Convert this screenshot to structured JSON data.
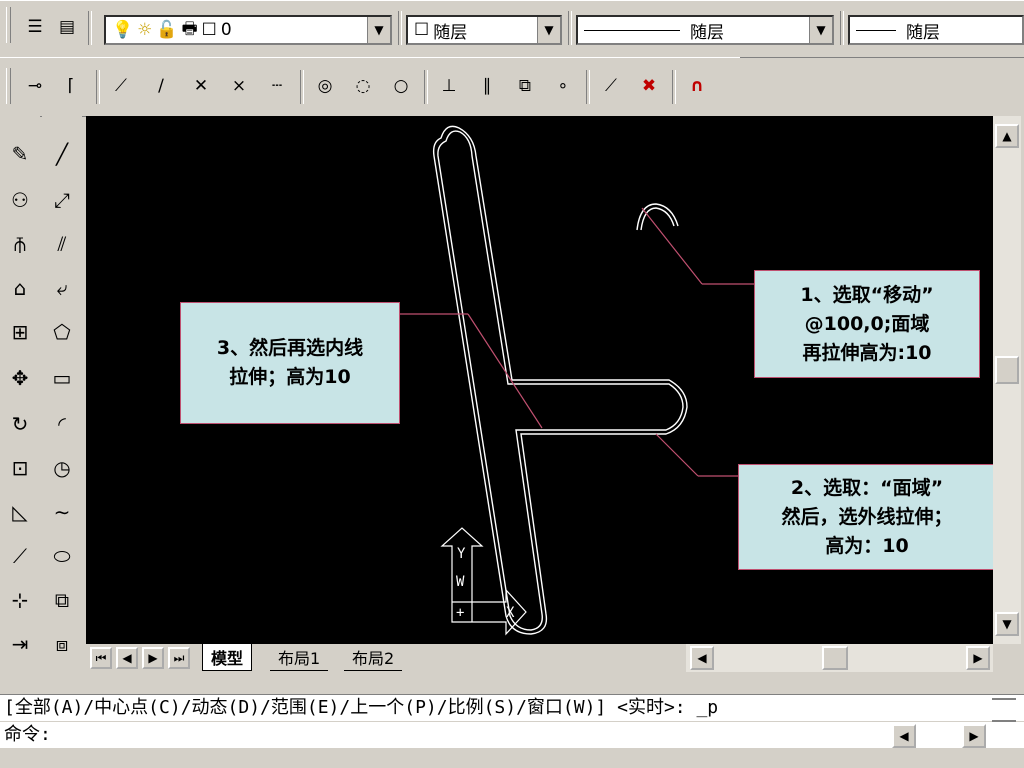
{
  "properties_toolbar": {
    "layer_name": "0",
    "color_value": "随层",
    "linetype_value": "随层",
    "lineweight_value": "随层"
  },
  "layout_tabs": [
    "模型",
    "布局1",
    "布局2"
  ],
  "command": {
    "history_line": "[全部(A)/中心点(C)/动态(D)/范围(E)/上一个(P)/比例(S)/窗口(W)] <实时>: _p",
    "prompt": "命令:"
  },
  "ucs": {
    "y_label": "Y",
    "w_label": "W",
    "x_label": "X"
  },
  "annotations": {
    "note1": [
      "1、选取“移动”",
      "@100,0;面域",
      "再拉伸高为:10"
    ],
    "note2": [
      "2、选取：“面域”",
      "然后，选外线拉伸；",
      "高为：10"
    ],
    "note3": [
      "3、然后再选内线",
      "拉伸；高为10"
    ]
  },
  "colors": {
    "annotation_bg": "#c8e4e6",
    "annotation_border": "#c05070",
    "canvas_bg": "#000000"
  }
}
